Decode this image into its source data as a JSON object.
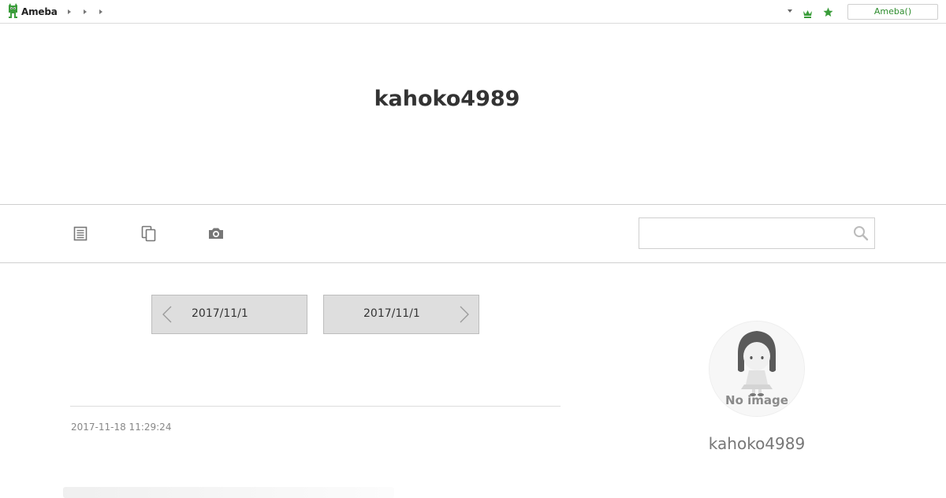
{
  "header": {
    "logo_text": "Ameba",
    "account_button_label": "Ameba()",
    "icons": [
      "ameba-logo-icon",
      "crown-icon",
      "star-icon",
      "chevron-down-icon"
    ],
    "accent_color": "#2d8c2d"
  },
  "blog": {
    "title": "kahoko4989"
  },
  "nav": {
    "icons": [
      "article-list-icon",
      "copy-pages-icon",
      "camera-icon"
    ],
    "search": {
      "placeholder": "",
      "value": ""
    }
  },
  "pager": {
    "prev_label": "2017/11/1",
    "next_label": "2017/11/1"
  },
  "entry": {
    "date": "2017-11-18 11:29:24"
  },
  "sidebar": {
    "profile_name": "kahoko4989",
    "avatar_caption": "No image"
  }
}
